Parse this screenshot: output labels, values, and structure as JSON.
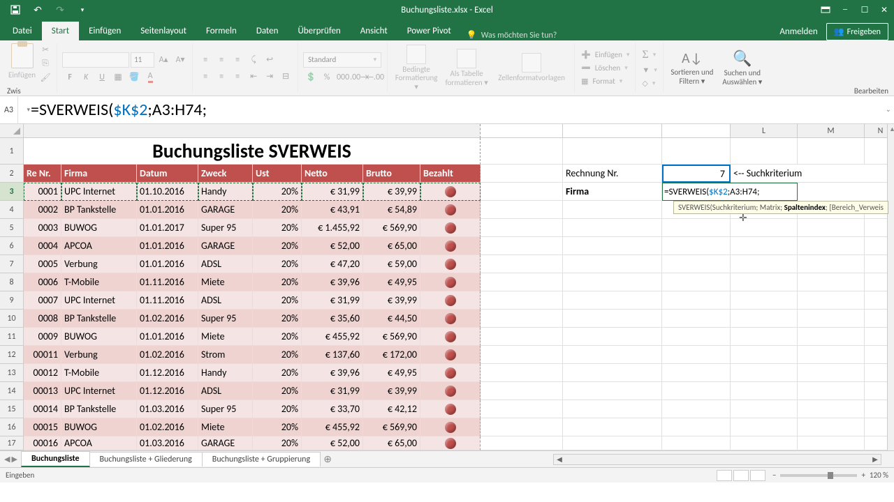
{
  "window": {
    "title": "Buchungsliste.xlsx - Excel"
  },
  "tabs": {
    "datei": "Datei",
    "start": "Start",
    "einfuegen": "Einfügen",
    "seitenlayout": "Seitenlayout",
    "formeln": "Formeln",
    "daten": "Daten",
    "ueberpruefen": "Überprüfen",
    "ansicht": "Ansicht",
    "powerpivot": "Power Pivot",
    "tellme": "Was möchten Sie tun?",
    "anmelden": "Anmelden",
    "freigeben": "Freigeben"
  },
  "ribbon": {
    "einfuegen": "Einfügen",
    "font_size": "11",
    "number_format": "Standard",
    "bedingte": "Bedingte Formatierung",
    "alstabelle": "Als Tabelle formatieren",
    "zellenformat": "Zellenformatvorlagen",
    "ins": "Einfügen",
    "del": "Löschen",
    "fmt": "Format",
    "sort": "Sortieren und Filtern",
    "find": "Suchen und Auswählen",
    "mode": "Bearbeiten",
    "group_zws": "Zwis"
  },
  "name_box": "A3",
  "formula": {
    "prefix": "=SVERWEIS(",
    "arg1": "$K$2",
    "sep1": ";",
    "arg2": "A3:H74",
    "sep2": ";"
  },
  "cols_right": {
    "L": "L",
    "M": "M",
    "N": "N"
  },
  "title_cell": "Buchungsliste SVERWEIS",
  "headers": [
    "Re Nr.",
    "Firma",
    "Datum",
    "Zweck",
    "Ust",
    "Netto",
    "Brutto",
    "Bezahlt"
  ],
  "rows": [
    {
      "nr": "0001",
      "firma": "UPC Internet",
      "datum": "01.10.2016",
      "zweck": "Handy",
      "ust": "20%",
      "netto": "€      31,99",
      "brutto": "€ 39,99"
    },
    {
      "nr": "0002",
      "firma": "BP Tankstelle",
      "datum": "01.01.2016",
      "zweck": "GARAGE",
      "ust": "20%",
      "netto": "€      43,91",
      "brutto": "€ 54,89"
    },
    {
      "nr": "0003",
      "firma": "BUWOG",
      "datum": "01.01.2017",
      "zweck": "Super 95",
      "ust": "20%",
      "netto": "€ 1.455,92",
      "brutto": "€ 569,90"
    },
    {
      "nr": "0004",
      "firma": "APCOA",
      "datum": "01.01.2016",
      "zweck": "GARAGE",
      "ust": "20%",
      "netto": "€      52,00",
      "brutto": "€ 65,00"
    },
    {
      "nr": "0005",
      "firma": "Verbung",
      "datum": "01.01.2016",
      "zweck": "ADSL",
      "ust": "20%",
      "netto": "€      47,20",
      "brutto": "€ 59,00"
    },
    {
      "nr": "0006",
      "firma": "T-Mobile",
      "datum": "01.11.2016",
      "zweck": "Miete",
      "ust": "20%",
      "netto": "€      39,96",
      "brutto": "€ 49,95"
    },
    {
      "nr": "0007",
      "firma": "UPC Internet",
      "datum": "01.11.2016",
      "zweck": "ADSL",
      "ust": "20%",
      "netto": "€      31,99",
      "brutto": "€ 39,99"
    },
    {
      "nr": "0008",
      "firma": "BP Tankstelle",
      "datum": "01.02.2016",
      "zweck": "Super 95",
      "ust": "20%",
      "netto": "€      35,60",
      "brutto": "€ 44,50"
    },
    {
      "nr": "0009",
      "firma": "BUWOG",
      "datum": "01.01.2016",
      "zweck": "Miete",
      "ust": "20%",
      "netto": "€    455,92",
      "brutto": "€ 569,90"
    },
    {
      "nr": "00011",
      "firma": "Verbung",
      "datum": "01.02.2016",
      "zweck": "Strom",
      "ust": "20%",
      "netto": "€    137,60",
      "brutto": "€ 172,00"
    },
    {
      "nr": "00012",
      "firma": "T-Mobile",
      "datum": "01.12.2016",
      "zweck": "Handy",
      "ust": "20%",
      "netto": "€      39,96",
      "brutto": "€ 49,95"
    },
    {
      "nr": "00013",
      "firma": "UPC Internet",
      "datum": "01.12.2016",
      "zweck": "ADSL",
      "ust": "20%",
      "netto": "€      31,99",
      "brutto": "€ 39,99"
    },
    {
      "nr": "00014",
      "firma": "BP Tankstelle",
      "datum": "01.03.2016",
      "zweck": "Super 95",
      "ust": "20%",
      "netto": "€      33,70",
      "brutto": "€ 42,12"
    },
    {
      "nr": "00015",
      "firma": "BUWOG",
      "datum": "01.02.2016",
      "zweck": "Miete",
      "ust": "20%",
      "netto": "€    455,92",
      "brutto": "€ 569,90"
    },
    {
      "nr": "00016",
      "firma": "APCOA",
      "datum": "01.03.2016",
      "zweck": "GARAGE",
      "ust": "20%",
      "netto": "€      52,00",
      "brutto": "€ 65,00"
    }
  ],
  "lookup": {
    "rechnung_label": "Rechnung Nr.",
    "rechnung_value": "7",
    "suchkriterium": "<-- Suchkriterium",
    "firma_label": "Firma",
    "formula_pre": "=SVERWEIS(",
    "formula_a1": "$K$2",
    "formula_s1": ";",
    "formula_a2": "A3:H74",
    "formula_s2": ";",
    "tooltip_pre": "SVERWEIS(Suchkriterium; Matrix; ",
    "tooltip_bold": "Spaltenindex",
    "tooltip_post": "; [Bereich_Verweis"
  },
  "sheets": {
    "s1": "Buchungsliste",
    "s2": "Buchungsliste + Gliederung",
    "s3": "Buchungsliste + Gruppierung"
  },
  "status": {
    "mode": "Eingeben",
    "zoom": "120 %"
  }
}
